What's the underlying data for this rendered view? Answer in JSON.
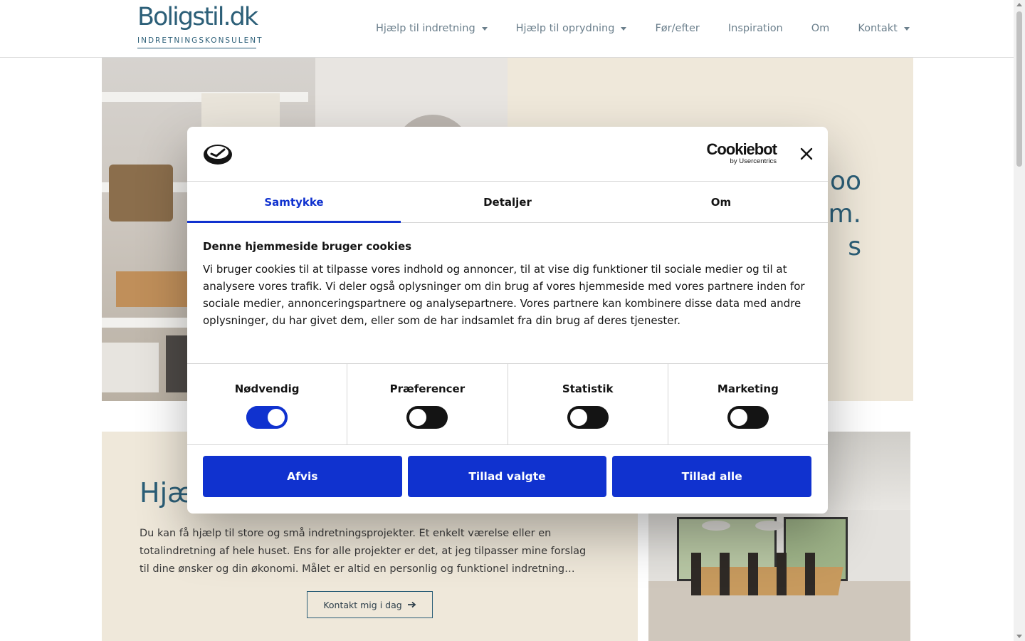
{
  "site": {
    "logo_main": "Boligstil.dk",
    "logo_sub": "INDRETNINGSKONSULENT",
    "accent_color": "#2c5f78"
  },
  "nav": {
    "items": [
      {
        "label": "Hjælp til indretning",
        "has_dropdown": true
      },
      {
        "label": "Hjælp til oprydning",
        "has_dropdown": true
      },
      {
        "label": "Før/efter",
        "has_dropdown": false
      },
      {
        "label": "Inspiration",
        "has_dropdown": false
      },
      {
        "label": "Om",
        "has_dropdown": false
      },
      {
        "label": "Kontakt",
        "has_dropdown": true
      }
    ]
  },
  "hero": {
    "partial_text": [
      "oo",
      "m.",
      "s"
    ]
  },
  "section2": {
    "heading_partial": "Hjæ",
    "text": "Du kan få hjælp til store og små indretningsprojekter. Et enkelt værelse eller en totalindretning af hele huset. Ens for alle projekter er det, at jeg tilpasser mine forslag til dine ønsker og din økonomi. Målet er altid en personlig og funktionel indretning…",
    "button_label": "Kontakt mig i dag",
    "button_icon": "arrow-right-icon"
  },
  "cookie": {
    "brand_main": "Cookiebot",
    "brand_sub": "by Usercentrics",
    "tabs": [
      "Samtykke",
      "Detaljer",
      "Om"
    ],
    "active_tab": "Samtykke",
    "title": "Denne hjemmeside bruger cookies",
    "body": "Vi bruger cookies til at tilpasse vores indhold og annoncer, til at vise dig funktioner til sociale medier og til at analysere vores trafik. Vi deler også oplysninger om din brug af vores hjemmeside med vores partnere inden for sociale medier, annonceringspartnere og analysepartnere. Vores partnere kan kombinere disse data med andre oplysninger, du har givet dem, eller som de har indsamlet fra din brug af deres tjenester.",
    "toggles": [
      {
        "label": "Nødvendig",
        "on": true
      },
      {
        "label": "Præferencer",
        "on": false
      },
      {
        "label": "Statistik",
        "on": false
      },
      {
        "label": "Marketing",
        "on": false
      }
    ],
    "buttons": [
      "Afvis",
      "Tillad valgte",
      "Tillad alle"
    ],
    "button_color": "#1032cf"
  }
}
